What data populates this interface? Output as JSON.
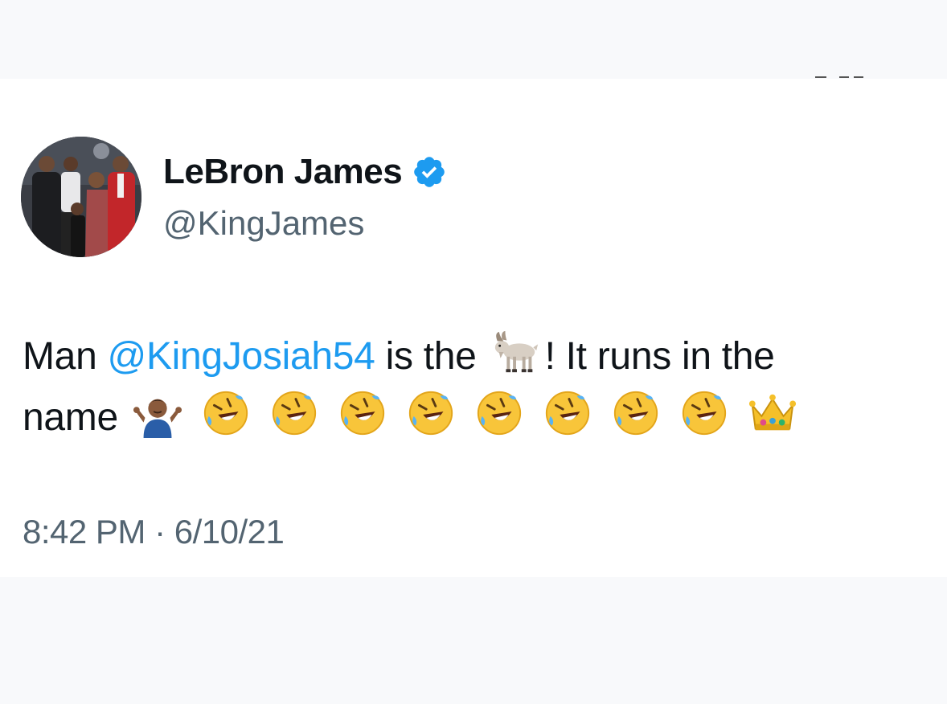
{
  "tweet": {
    "author": {
      "display_name": "LeBron James",
      "handle": "@KingJames",
      "verified": true,
      "avatar_icon": "profile-photo"
    },
    "text": {
      "part1": "Man ",
      "mention": "@KingJosiah54",
      "part2": " is the ",
      "part3": "! It runs in the",
      "part4": "name",
      "emojis": [
        "goat-emoji",
        "person-shrugging-emoji",
        "rolling-on-floor-laughing-emoji",
        "crown-emoji"
      ],
      "laugh_count": 8
    },
    "time": "8:42 PM",
    "separator": "·",
    "date": "6/10/21"
  },
  "colors": {
    "text_primary": "#0f1419",
    "text_secondary": "#536471",
    "link": "#1d9bf0",
    "verified": "#1d9bf0",
    "page_background": "#f8f9fb",
    "card_background": "#ffffff"
  }
}
